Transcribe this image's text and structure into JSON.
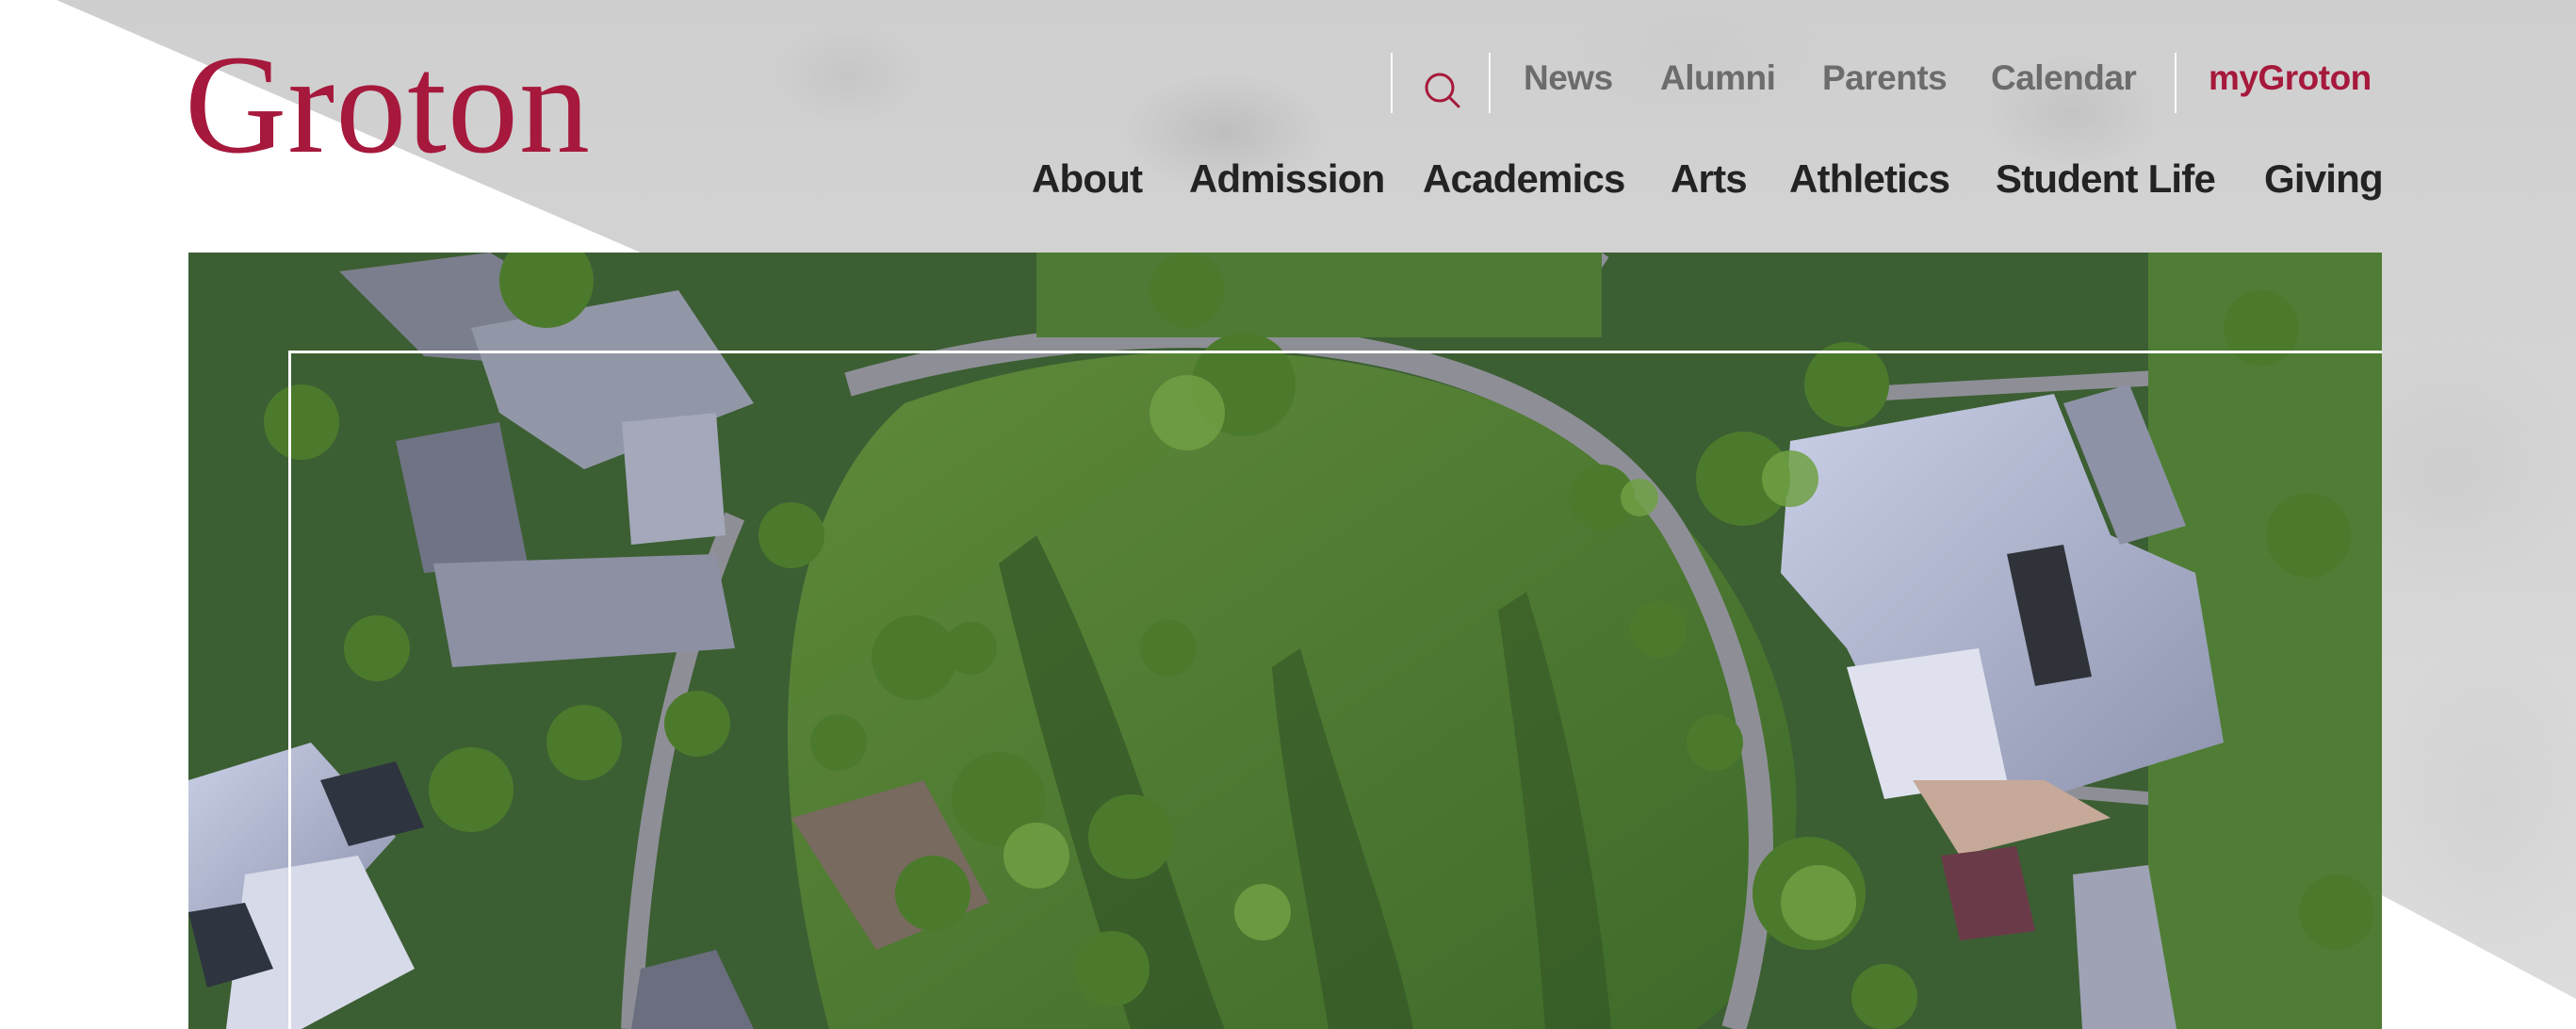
{
  "brand": {
    "logo_text": "Groton",
    "color": "#a6193c"
  },
  "utility_nav": {
    "search_icon": "search-icon",
    "links": [
      "News",
      "Alumni",
      "Parents",
      "Calendar"
    ],
    "account_link": "myGroton"
  },
  "main_nav": {
    "items": [
      "About",
      "Admission",
      "Academics",
      "Arts",
      "Athletics",
      "Student Life",
      "Giving"
    ]
  },
  "hero": {
    "image": "aerial campus photo with circular lawn and buildings"
  }
}
